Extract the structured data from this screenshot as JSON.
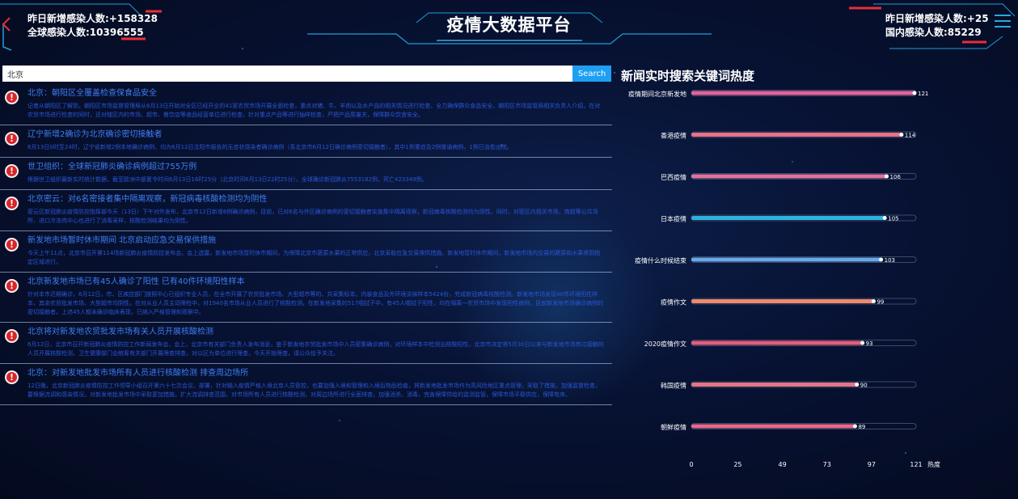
{
  "header": {
    "left_line1": "昨日新增感染人数:+158328",
    "left_line2": "全球感染人数:10396555",
    "title": "疫情大数据平台",
    "right_line1": "昨日新增感染人数:+25",
    "right_line2": "国内感染人数:85229"
  },
  "search": {
    "value": "北京",
    "button_label": "Search"
  },
  "news": [
    {
      "title": "北京：朝阳区全覆盖检查保食品安全",
      "body": "记者从朝阳区了解到，朝阳区市场监督管理局从6月13日开始对全区已经开业的41家农贸市场开展全面检查，重点对猪、牛、羊肉以及水产品的相关情况进行检查，全力确保群众食品安全。朝阳区市场监管局相关负责人介绍，在对农贸市场进行检查的同时，还对辖区内的市场、超市、餐饮店等食品经营单位进行检查，针对重点产品等进行抽样检查，严把产品质量关，保障群众饮食安全。"
    },
    {
      "title": "辽宁新增2确诊为北京确诊密切接触者",
      "body": "6月13日0时至24时，辽宁省新增2例本地确诊病例，均为6月12日沈阳市报告的无症状感染者确诊病例（系北京市6月12日确诊病例密切接触者），其中1例重症及2例普通病例，1例已治愈出院。"
    },
    {
      "title": "世卫组织：全球新冠肺炎确诊病例超过755万例",
      "body": "根据世卫组织最新实时统计数据，截至欧洲中部夏令时间6月13日16时25分（北京时间6月13日22时25分），全球确诊新冠肺炎7553182例，死亡423349例。"
    },
    {
      "title": "北京密云：对6名密接者集中隔离观察，新冠病毒核酸检测均为阴性",
      "body": "密云区新冠肺炎疫情防控指挥部今天（13日）下午对外发布，北京市12日新增6例确诊病例，目前，已对6名与外区确诊病例的密切接触者实施集中隔离观察，新冠病毒核酸检测均为阴性。同时，对密区内相关市场、商超等公共场所、进口冷冻肉中心也进行了消毒采样，核酸检测结果均为阴性。"
    },
    {
      "title": "新发地市场暂时休市期间 北京启动应急交易保供措施",
      "body": "今天上午11点，北京市召开第114场新冠肺炎疫情防控发布会。会上透露，新发地市场暂时休市期间，为保障北京市蔬菜水果的正常供应，北京采取应急交易保供措施。新发地暂时休市期间，新发地市场内交易的蔬菜和水果将到指定区域进行。"
    },
    {
      "title": "北京新发地市场已有45人确诊了阳性 已有40件环境阳性样本",
      "body": "针对本市近期确诊，6月12日，市、区疾控部门按照中心已组织专业人员，在全市开展了农贸批发市场、大型超市等的、共采集标本。内装食品及外环境涂抹样本5424份，完成新冠病毒核酸检测。新发地市场发现40件环境阳性样本，其余农贸批发市场、大型超市均阴性。在对从业人员主动筛检中，对1940名市场从业人员进行了核酸检测，在新发地采集的517咽拭子中，有45人咽拭子阳性，均在隔离一农贸市场中发现阳性病例，目前新发地市场确诊病例的密切接触者，上述45人都未确诊临床表现，已纳入严格管理和观察中。"
    },
    {
      "title": "北京将对新发地农贸批发市场有关人员开展核酸检测",
      "body": "6月12日，北京市召开新冠肺炎疫情防控工作新闻发布会，会上，北京市有关部门负责人发布消息，鉴于新发地农贸批发市场中人员密集确诊病例，对环境样本中检测出核酸阳性，北京市决定将5月30日以来与新发地市场有过接触的人员开展核酸检测，卫生健康部门会统筹有关部门开展筛查排查，对以区为单位进行筛查，今天开始筛查，请公众给予关注。"
    },
    {
      "title": "北京：对新发地批发市场所有人员进行核酸检测 排查周边场所",
      "body": "12日晚，北京新冠肺炎疫情防控工作领导小组召开第六十七次会议。部署，针对输入疫情严格入境北京人员管控，也要加强入境和管理和入境后物品检疫，将新发地批发市场作为高风险地区重点管理，采取了措施，加强监督检查，要根据流调和感染情况，对新发地批发市场中采取更加措施，扩大流调排查范围，对市场所有人员进行核酸检测，对周边场所进行全面排查，加强消杀、消毒，完善保障供给的监测监管，保障市场平稳供应，保障有序。"
    }
  ],
  "keywords_panel": {
    "title": "新闻实时搜索关键词热度",
    "value_unit": "热度"
  },
  "chart_data": {
    "type": "bar",
    "orientation": "horizontal",
    "title": "新闻实时搜索关键词热度",
    "categories": [
      "疫情期间北京新发地",
      "香港疫情",
      "巴西疫情",
      "日本疫情",
      "疫情什么时候结束",
      "疫情作文",
      "2020疫情作文",
      "韩国疫情",
      "朝鲜疫情"
    ],
    "values": [
      121,
      114,
      106,
      105,
      103,
      99,
      93,
      90,
      89
    ],
    "bar_colors": [
      "#e6629b",
      "#ec6f86",
      "#e0739f",
      "#2bb3de",
      "#6aa9e8",
      "#f08a6b",
      "#e85c78",
      "#e87384",
      "#e8688a"
    ],
    "x_ticks": [
      "0",
      "25",
      "49",
      "73",
      "97",
      "121"
    ],
    "xlabel": "热度",
    "xlim": [
      0,
      121
    ]
  }
}
